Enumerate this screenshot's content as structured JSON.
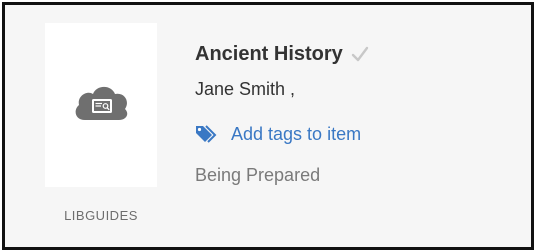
{
  "item": {
    "title": "Ancient History",
    "author": "Jane Smith ,",
    "tags_link": "Add tags to item",
    "status": "Being Prepared",
    "resource_type": "LIBGUIDES"
  },
  "icons": {
    "thumbnail": "cloud-document-icon",
    "verified": "check-icon",
    "tags": "tags-icon"
  },
  "colors": {
    "link": "#3a78c4",
    "status": "#7a7a7a",
    "title": "#333333"
  }
}
